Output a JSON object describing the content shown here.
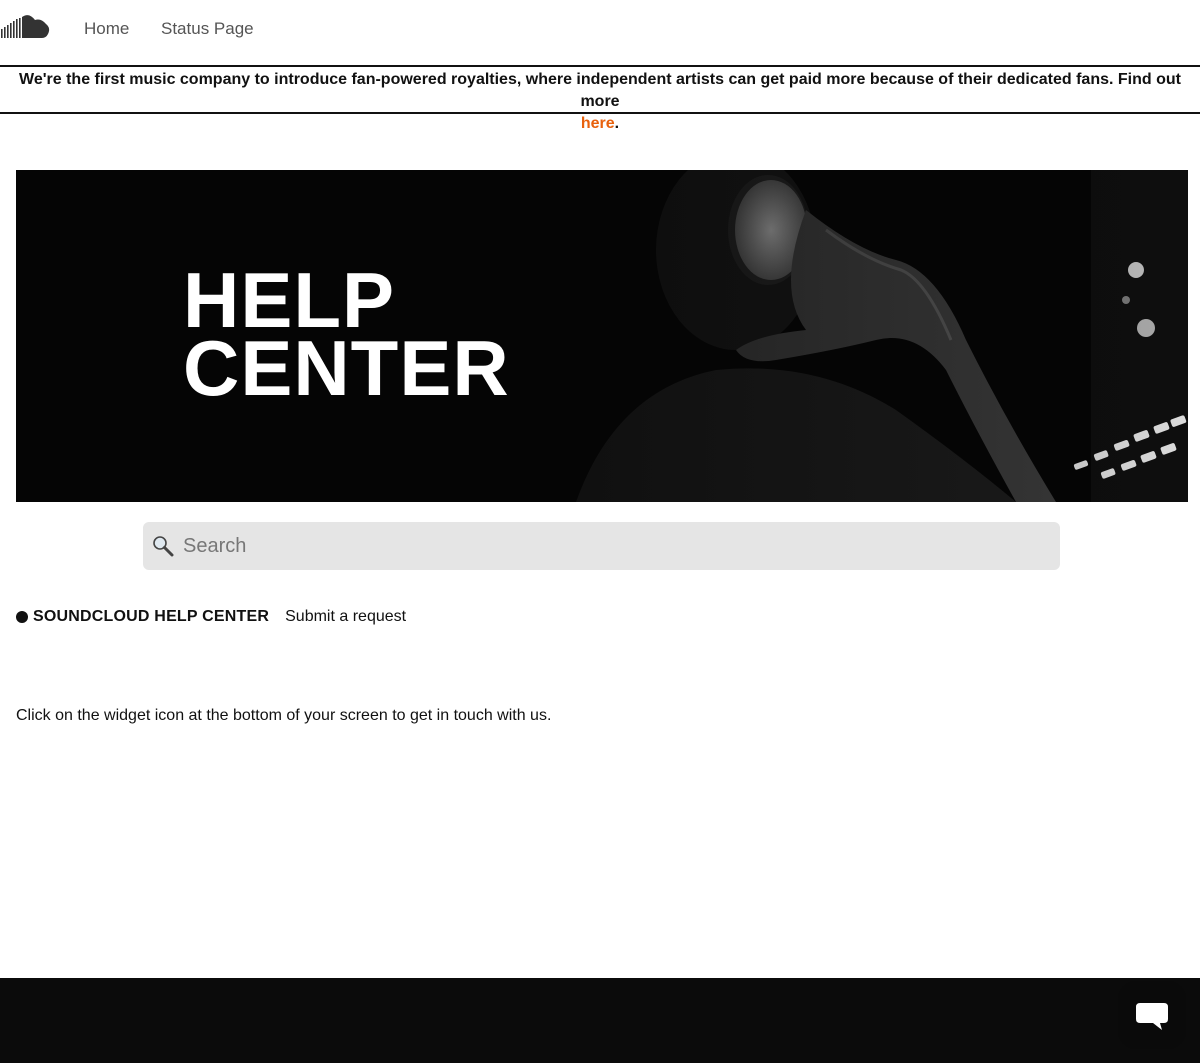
{
  "nav": {
    "logo_icon": "soundcloud-cloud-icon",
    "home_label": "Home",
    "status_label": "Status Page"
  },
  "announcement": {
    "text": "We're the first music company to introduce fan-powered royalties, where independent artists can get paid more because of their dedicated fans. Find out more ",
    "link_label": "here",
    "trailing": ".",
    "link_color": "#e8610d"
  },
  "hero": {
    "title_line1": "HELP",
    "title_line2": "CENTER",
    "image_subject": "person-with-headphones-at-mixing-desk"
  },
  "search": {
    "placeholder": "Search",
    "icon": "search-icon"
  },
  "breadcrumb": {
    "home_label": "SOUNDCLOUD HELP CENTER",
    "request_label": "Submit a request"
  },
  "main": {
    "message": "Click on the widget icon at the bottom of your screen to get in touch with us."
  },
  "widget": {
    "icon": "chat-bubble-icon"
  }
}
